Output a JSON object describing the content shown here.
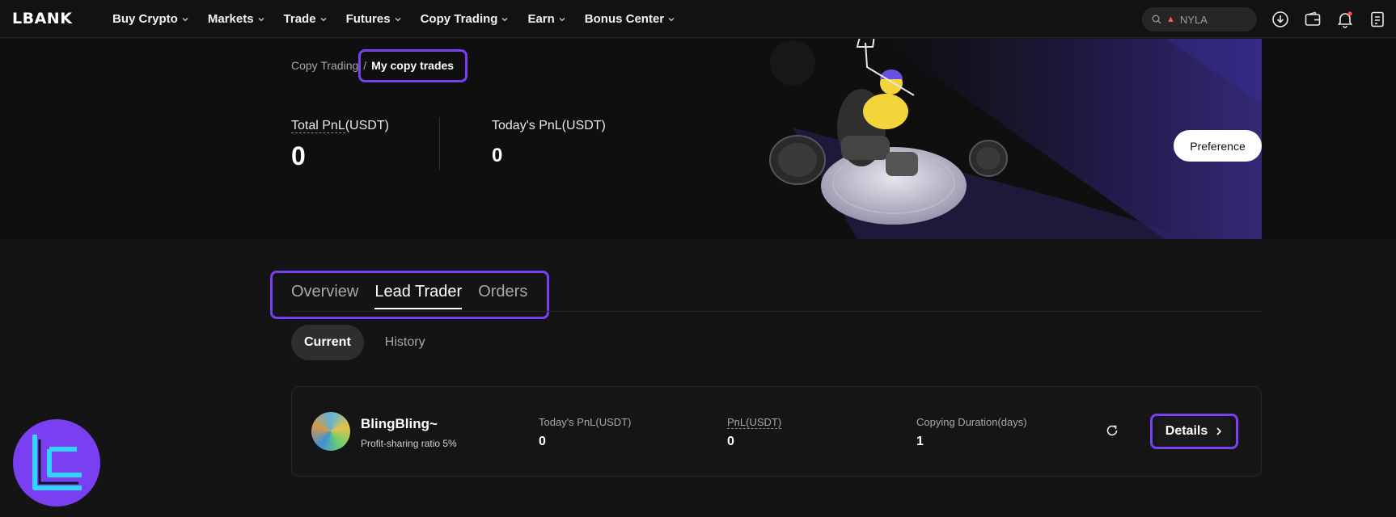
{
  "brand": {
    "logo": "LBANK"
  },
  "nav": {
    "items": [
      {
        "label": "Buy Crypto"
      },
      {
        "label": "Markets"
      },
      {
        "label": "Trade"
      },
      {
        "label": "Futures"
      },
      {
        "label": "Copy Trading"
      },
      {
        "label": "Earn"
      },
      {
        "label": "Bonus Center"
      }
    ],
    "search_placeholder": "NYLA"
  },
  "breadcrumb": {
    "parent": "Copy Trading",
    "separator": "/",
    "current": "My copy trades"
  },
  "stats": {
    "total_pnl_label_main": "Total PnL",
    "total_pnl_label_unit": "(USDT)",
    "total_pnl_value": "0",
    "today_pnl_label": "Today's PnL(USDT)",
    "today_pnl_value": "0"
  },
  "preference_label": "Preference",
  "tabs": [
    {
      "label": "Overview",
      "active": false
    },
    {
      "label": "Lead Trader",
      "active": true
    },
    {
      "label": "Orders",
      "active": false
    }
  ],
  "subtabs": [
    {
      "label": "Current",
      "active": true
    },
    {
      "label": "History",
      "active": false
    }
  ],
  "trader": {
    "name": "BlingBling~",
    "profit_sharing": "Profit-sharing ratio 5%",
    "today_pnl_label": "Today's PnL(USDT)",
    "today_pnl_value": "0",
    "pnl_label": "PnL(USDT)",
    "pnl_value": "0",
    "duration_label": "Copying Duration(days)",
    "duration_value": "1",
    "details_label": "Details"
  },
  "colors": {
    "accent": "#7b3ff2",
    "background": "#141414",
    "hero": "#0f0f0f",
    "notification": "#ff4d4f"
  }
}
